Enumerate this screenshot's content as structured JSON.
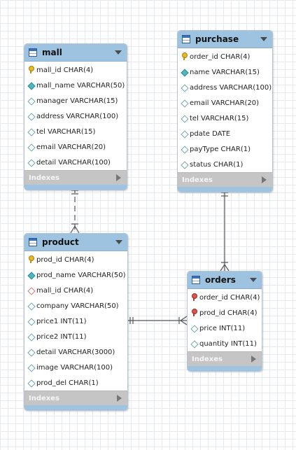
{
  "tables": {
    "mall": {
      "name": "mall",
      "indexes_label": "Indexes",
      "columns": [
        {
          "text": "mall_id CHAR(4)",
          "icon": "primary-key-icon"
        },
        {
          "text": "mall_name VARCHAR(50)",
          "icon": "not-null-column-icon"
        },
        {
          "text": "manager VARCHAR(15)",
          "icon": "nullable-column-icon"
        },
        {
          "text": "address VARCHAR(100)",
          "icon": "nullable-column-icon"
        },
        {
          "text": "tel VARCHAR(15)",
          "icon": "nullable-column-icon"
        },
        {
          "text": "email VARCHAR(20)",
          "icon": "nullable-column-icon"
        },
        {
          "text": "detail VARCHAR(100)",
          "icon": "nullable-column-icon"
        }
      ]
    },
    "purchase": {
      "name": "purchase",
      "indexes_label": "Indexes",
      "columns": [
        {
          "text": "order_id CHAR(4)",
          "icon": "primary-key-icon"
        },
        {
          "text": "name VARCHAR(15)",
          "icon": "not-null-column-icon"
        },
        {
          "text": "address VARCHAR(100)",
          "icon": "nullable-column-icon"
        },
        {
          "text": "email VARCHAR(20)",
          "icon": "nullable-column-icon"
        },
        {
          "text": "tel VARCHAR(15)",
          "icon": "nullable-column-icon"
        },
        {
          "text": "pdate DATE",
          "icon": "nullable-column-icon"
        },
        {
          "text": "payType CHAR(1)",
          "icon": "nullable-column-icon"
        },
        {
          "text": "status CHAR(1)",
          "icon": "nullable-column-icon"
        }
      ]
    },
    "product": {
      "name": "product",
      "indexes_label": "Indexes",
      "columns": [
        {
          "text": "prod_id CHAR(4)",
          "icon": "primary-key-icon"
        },
        {
          "text": "prod_name VARCHAR(50)",
          "icon": "not-null-column-icon"
        },
        {
          "text": "mall_id CHAR(4)",
          "icon": "foreign-key-column-icon"
        },
        {
          "text": "company VARCHAR(50)",
          "icon": "nullable-column-icon"
        },
        {
          "text": "price1 INT(11)",
          "icon": "nullable-column-icon"
        },
        {
          "text": "price2 INT(11)",
          "icon": "nullable-column-icon"
        },
        {
          "text": "detail VARCHAR(3000)",
          "icon": "nullable-column-icon"
        },
        {
          "text": "image VARCHAR(100)",
          "icon": "nullable-column-icon"
        },
        {
          "text": "prod_del CHAR(1)",
          "icon": "nullable-column-icon"
        }
      ]
    },
    "orders": {
      "name": "orders",
      "indexes_label": "Indexes",
      "columns": [
        {
          "text": "order_id CHAR(4)",
          "icon": "primary-foreign-key-icon"
        },
        {
          "text": "prod_id CHAR(4)",
          "icon": "primary-foreign-key-icon"
        },
        {
          "text": "price INT(11)",
          "icon": "nullable-column-icon"
        },
        {
          "text": "quantity INT(11)",
          "icon": "nullable-column-icon"
        }
      ]
    }
  },
  "colors": {
    "header": "#9dc3e0",
    "footer": "#c5c5c5",
    "connector": "#555555"
  }
}
